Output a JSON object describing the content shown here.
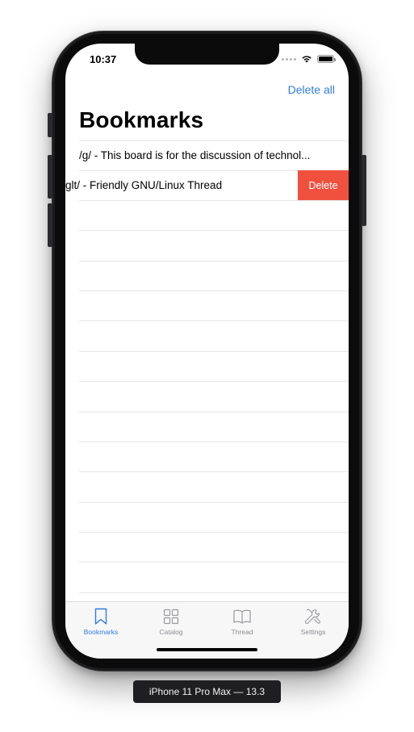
{
  "status_bar": {
    "time": "10:37"
  },
  "nav": {
    "right_action": "Delete all",
    "title": "Bookmarks"
  },
  "bookmarks": [
    {
      "text": "/g/ - This board is for the discussion of technol..."
    },
    {
      "text": "glt/ - Friendly GNU/Linux Thread",
      "swipe_action": "Delete"
    }
  ],
  "tab_bar": {
    "active": "Bookmarks",
    "tabs": [
      {
        "label": "Bookmarks",
        "icon": "bookmark-icon"
      },
      {
        "label": "Catalog",
        "icon": "grid-icon"
      },
      {
        "label": "Thread",
        "icon": "book-icon"
      },
      {
        "label": "Settings",
        "icon": "wrench-screwdriver-icon"
      }
    ]
  },
  "simulator_label": "iPhone 11 Pro Max — 13.3",
  "colors": {
    "accent": "#2f7de1",
    "delete": "#f0513f"
  }
}
